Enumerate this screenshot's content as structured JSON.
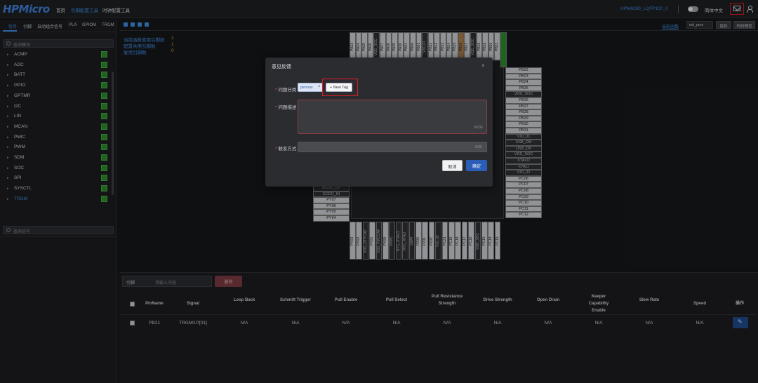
{
  "header": {
    "logo": "HPMicro",
    "nav": [
      "首页",
      "引脚配置工具",
      "时钟配置工具"
    ],
    "device": "HPM6280_LQFP100_0",
    "language": "简体中文"
  },
  "left_panel": {
    "tabs": [
      "信号",
      "引脚",
      "自动组合信号",
      "PLA",
      "GPIOM",
      "TRGM"
    ],
    "search_placeholder": "查询模块",
    "modules": [
      "ACMP",
      "ADC",
      "BATT",
      "GPIO",
      "GPTMR",
      "I2C",
      "LIN",
      "MCAN",
      "PMIC",
      "PWM",
      "SDM",
      "SOC",
      "SPI",
      "SYSCTL",
      "TRGM"
    ],
    "signal_search_placeholder": "查询信号"
  },
  "toolbar": {
    "link_label": "当前函数",
    "select_value": "init_pins",
    "btn_save": "保存",
    "btn_code": "代码预览"
  },
  "stats": [
    {
      "label": "当前函数使用引脚数",
      "value": "1"
    },
    {
      "label": "配置共用引脚数",
      "value": "1"
    },
    {
      "label": "复用引脚数",
      "value": "0"
    }
  ],
  "chip": {
    "top_pins": [
      "PA23",
      "PA24",
      "PA25",
      "PA26",
      "VDD_SOC",
      "PA27",
      "PA28",
      "PA29",
      "PA30",
      "PA31",
      "PB00",
      "PB01",
      "VIO_01",
      "PB11",
      "PB12",
      "PB13",
      "PB14",
      "PB15",
      "PB16",
      "PB17",
      "VDD_SOC",
      "PB18",
      "PB19",
      "PB20",
      "PB21"
    ],
    "right_pins": [
      "PB22",
      "PB23",
      "PB24",
      "PB25",
      "VDD_SOC",
      "PB26",
      "PB27",
      "PB28",
      "PB29",
      "PB30",
      "PB31",
      "VIO_01",
      "USB_DM",
      "USB_DP",
      "VDD_SOC",
      "XTALO",
      "XTALI",
      "VIO_02",
      "PC06",
      "PC07",
      "PC08",
      "PC09",
      "PC10",
      "PC11",
      "PC12"
    ],
    "left_pins": [
      "DCDC_LP",
      "DCDC_IN",
      "PY07",
      "PY06",
      "PY05",
      "PY04"
    ],
    "bottom_pins": [
      "PY03",
      "PY02",
      "VDD_OTPCAP",
      "PY01",
      "VDD_PMCCAP",
      "PY00",
      "VPMC",
      "RTC_XTALO",
      "RTC_XTALI",
      "VBAT",
      "PZ00",
      "PZ01",
      "PZ02",
      "VIO_02",
      "PC21",
      "PC19",
      "PC18",
      "PC17",
      "PC16",
      "VDD_SOC",
      "PC15",
      "PC14",
      "PC13"
    ]
  },
  "bottom": {
    "filter_select": "引脚",
    "filter_placeholder": "请输入内容",
    "delete_label": "删除",
    "columns": [
      "PinName",
      "Signal",
      "Loop Back",
      "Schmitt Trigger",
      "Pull Enable",
      "Pull Select",
      "Pull Resistance Strength",
      "Drive Strength",
      "Open Drain",
      "Keeper Capability Enable",
      "Slew Rate",
      "Speed",
      "操作"
    ],
    "rows": [
      [
        "PB21",
        "TRGM0.P[01]",
        "N/A",
        "N/A",
        "N/A",
        "N/A",
        "N/A",
        "N/A",
        "N/A",
        "N/A",
        "N/A",
        "N/A"
      ]
    ]
  },
  "modal": {
    "title": "意见反馈",
    "label_category": "问题分类",
    "tag": "pinmux",
    "new_tag": "+ New Tag",
    "label_description": "问题描述",
    "desc_counter": "0/200",
    "label_contact": "联系方式",
    "contact_counter": "0/30",
    "cancel": "取消",
    "ok": "确定"
  }
}
